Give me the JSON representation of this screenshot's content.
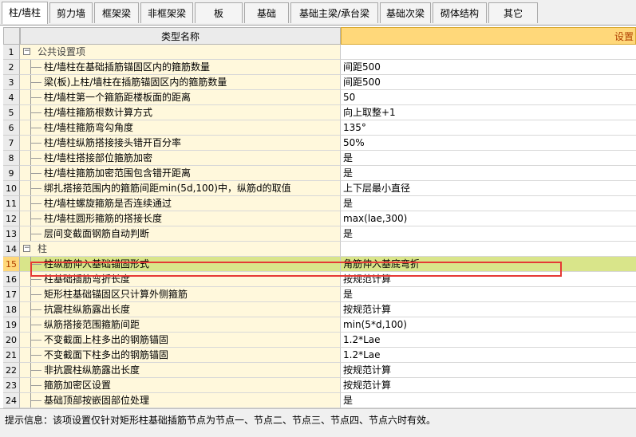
{
  "tabs": [
    "柱/墙柱",
    "剪力墙",
    "框架梁",
    "非框架梁",
    "板",
    "基础",
    "基础主梁/承台梁",
    "基础次梁",
    "砌体结构",
    "其它"
  ],
  "active_tab": 0,
  "columns": {
    "row_no": "",
    "name": "类型名称",
    "value": "设置"
  },
  "rows": [
    {
      "no": "1",
      "name": "公共设置项",
      "value": "",
      "group": true
    },
    {
      "no": "2",
      "name": "柱/墙柱在基础插筋锚固区内的箍筋数量",
      "value": "间距500"
    },
    {
      "no": "3",
      "name": "梁(板)上柱/墙柱在插筋锚固区内的箍筋数量",
      "value": "间距500"
    },
    {
      "no": "4",
      "name": "柱/墙柱第一个箍筋距楼板面的距离",
      "value": "50"
    },
    {
      "no": "5",
      "name": "柱/墙柱箍筋根数计算方式",
      "value": "向上取整+1"
    },
    {
      "no": "6",
      "name": "柱/墙柱箍筋弯勾角度",
      "value": "135°"
    },
    {
      "no": "7",
      "name": "柱/墙柱纵筋搭接接头错开百分率",
      "value": "50%"
    },
    {
      "no": "8",
      "name": "柱/墙柱搭接部位箍筋加密",
      "value": "是"
    },
    {
      "no": "9",
      "name": "柱/墙柱箍筋加密范围包含错开距离",
      "value": "是"
    },
    {
      "no": "10",
      "name": "绑扎搭接范围内的箍筋间距min(5d,100)中，纵筋d的取值",
      "value": "上下层最小直径"
    },
    {
      "no": "11",
      "name": "柱/墙柱螺旋箍筋是否连续通过",
      "value": "是"
    },
    {
      "no": "12",
      "name": "柱/墙柱圆形箍筋的搭接长度",
      "value": "max(lae,300)"
    },
    {
      "no": "13",
      "name": "层间变截面钢筋自动判断",
      "value": "是"
    },
    {
      "no": "14",
      "name": "柱",
      "value": "",
      "group": true
    },
    {
      "no": "15",
      "name": "柱纵筋伸入基础锚固形式",
      "value": "角筋伸入基底弯折",
      "selected": true
    },
    {
      "no": "16",
      "name": "柱基础插筋弯折长度",
      "value": "按规范计算"
    },
    {
      "no": "17",
      "name": "矩形柱基础锚固区只计算外侧箍筋",
      "value": "是"
    },
    {
      "no": "18",
      "name": "抗震柱纵筋露出长度",
      "value": "按规范计算"
    },
    {
      "no": "19",
      "name": "纵筋搭接范围箍筋间距",
      "value": "min(5*d,100)"
    },
    {
      "no": "20",
      "name": "不变截面上柱多出的钢筋锚固",
      "value": "1.2*Lae"
    },
    {
      "no": "21",
      "name": "不变截面下柱多出的钢筋锚固",
      "value": "1.2*Lae"
    },
    {
      "no": "22",
      "name": "非抗震柱纵筋露出长度",
      "value": "按规范计算"
    },
    {
      "no": "23",
      "name": "箍筋加密区设置",
      "value": "按规范计算"
    },
    {
      "no": "24",
      "name": "基础顶部按嵌固部位处理",
      "value": "是"
    }
  ],
  "status_text": "提示信息：该项设置仅针对矩形柱基础插筋节点为节点一、节点二、节点三、节点四、节点六时有效。",
  "colors": {
    "header_value_bg": "#ffd87a",
    "name_bg": "#fff8dc",
    "selected_bg": "#d9e58a",
    "highlight": "#e53935"
  }
}
